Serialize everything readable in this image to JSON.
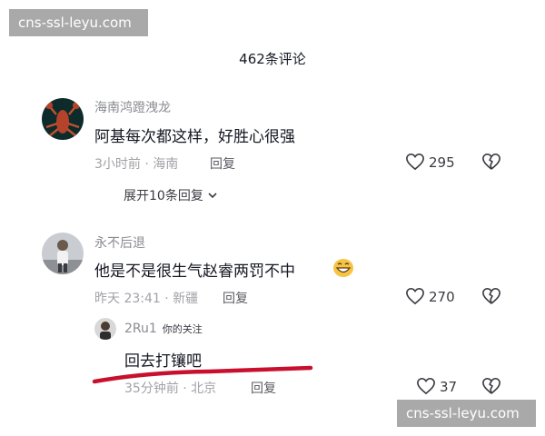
{
  "watermark": {
    "text": "cns-ssl-leyu.com"
  },
  "header": {
    "title": "462条评论"
  },
  "comments": [
    {
      "username": "海南鸿蹬洩龙",
      "text": "阿基每次都这样，好胜心很强",
      "time_location": "3小时前 · 海南",
      "reply_label": "回复",
      "likes": "295",
      "expand_label": "展开10条回复"
    },
    {
      "username": "永不后退",
      "text": "他是不是很生气赵睿两罚不中",
      "time_location": "昨天 23:41 · 新疆",
      "reply_label": "回复",
      "likes": "270"
    }
  ],
  "reply": {
    "username": "2Ru1",
    "tag": "你的关注",
    "text": "回去打镶吧",
    "time_location": "35分钟前 · 北京",
    "reply_label": "回复",
    "likes": "37"
  },
  "colors": {
    "underline": "#c8102e",
    "watermark_bg": "#969696",
    "emoji": "#f6c445"
  },
  "icons": [
    "heart-icon",
    "broken-heart-icon",
    "chevron-down-icon",
    "grin-emoji-icon"
  ]
}
